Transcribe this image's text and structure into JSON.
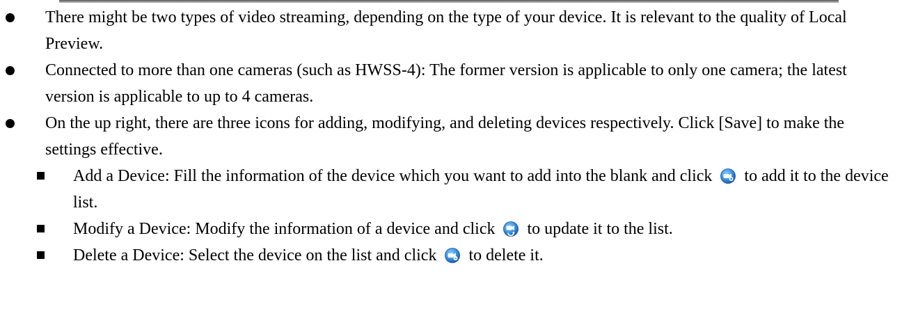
{
  "bullets": [
    {
      "text": "There might be two types of video streaming, depending on the type of your device. It is relevant to the quality of Local Preview."
    },
    {
      "text": "Connected to more than one cameras (such as HWSS-4): The former version is applicable to only one camera; the latest version is applicable to up to 4 cameras."
    },
    {
      "text": "On the up right, there are three icons for adding, modifying, and deleting devices respectively. Click [Save] to make the settings effective."
    }
  ],
  "sub_bullets": [
    {
      "before": "Add a Device: Fill the information of the device which you want to add into the blank and click",
      "after": "to add it to the device list.",
      "icon": "add-device-icon"
    },
    {
      "before": "Modify a Device: Modify the information of a device and click",
      "after": "to update it to the list.",
      "icon": "modify-device-icon"
    },
    {
      "before": "Delete a Device: Select the device on the list and click",
      "after": "to delete it.",
      "icon": "delete-device-icon"
    }
  ],
  "colors": {
    "icon_blue_outer": "#1e6fc9",
    "icon_blue_inner": "#5fb4f2",
    "icon_white": "#ffffff"
  }
}
